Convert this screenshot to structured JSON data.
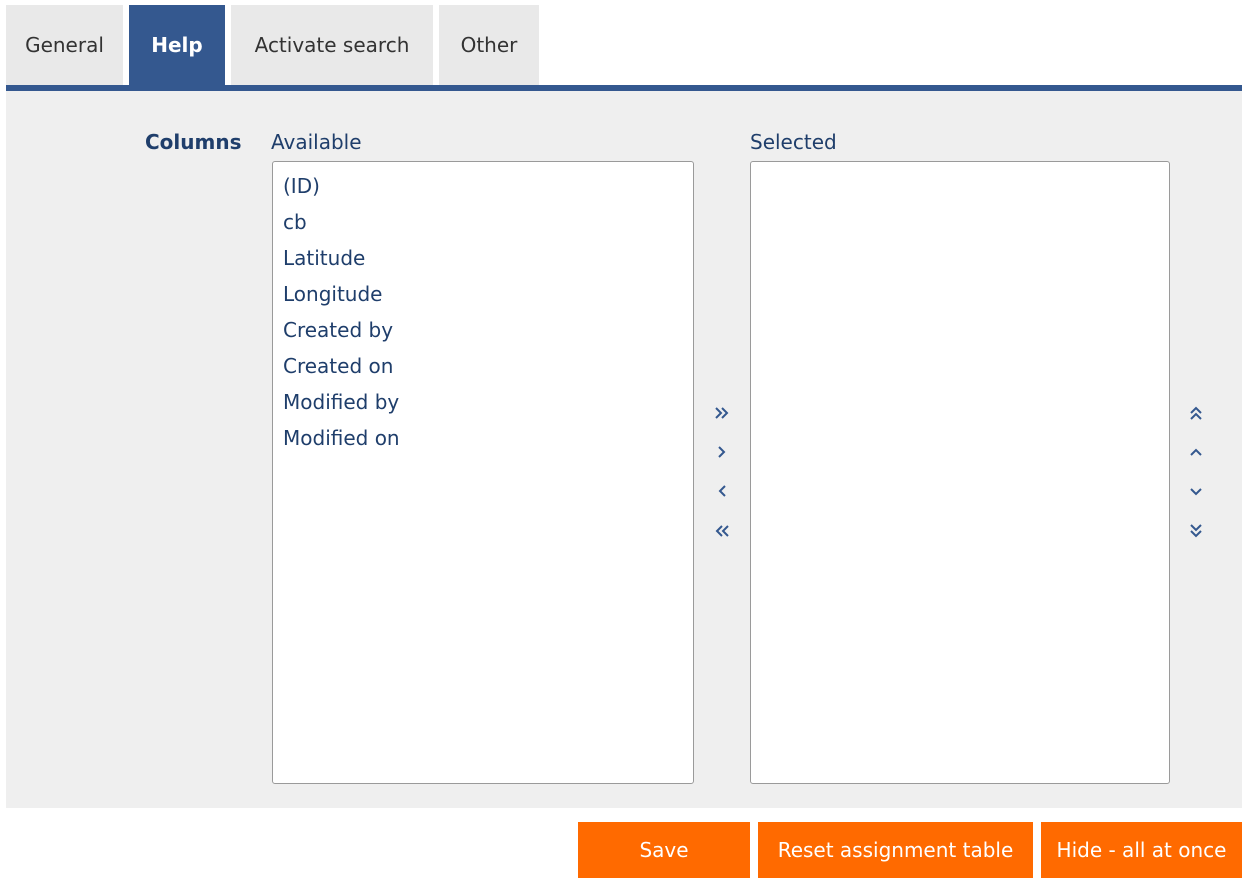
{
  "tabs": [
    {
      "label": "General",
      "active": false
    },
    {
      "label": "Help",
      "active": true
    },
    {
      "label": "Activate search",
      "active": false
    },
    {
      "label": "Other",
      "active": false
    }
  ],
  "form": {
    "columns_label": "Columns",
    "available_label": "Available",
    "selected_label": "Selected"
  },
  "available_items": [
    "(ID)",
    "cb",
    "Latitude",
    "Longitude",
    "Created by",
    "Created on",
    "Modified by",
    "Modified on"
  ],
  "selected_items": [],
  "transfer_icons": [
    "chevron-double-right-icon",
    "chevron-right-icon",
    "chevron-left-icon",
    "chevron-double-left-icon"
  ],
  "order_icons": [
    "chevron-double-up-icon",
    "chevron-up-icon",
    "chevron-down-icon",
    "chevron-double-down-icon"
  ],
  "buttons": {
    "save": "Save",
    "reset": "Reset assignment table",
    "hide_all": "Hide - all at once"
  },
  "colors": {
    "tab_active": "#34588f",
    "tab_inactive": "#e9e9e9",
    "panel": "#efefef",
    "text": "#1f3e6b",
    "button": "#ff6a00"
  }
}
